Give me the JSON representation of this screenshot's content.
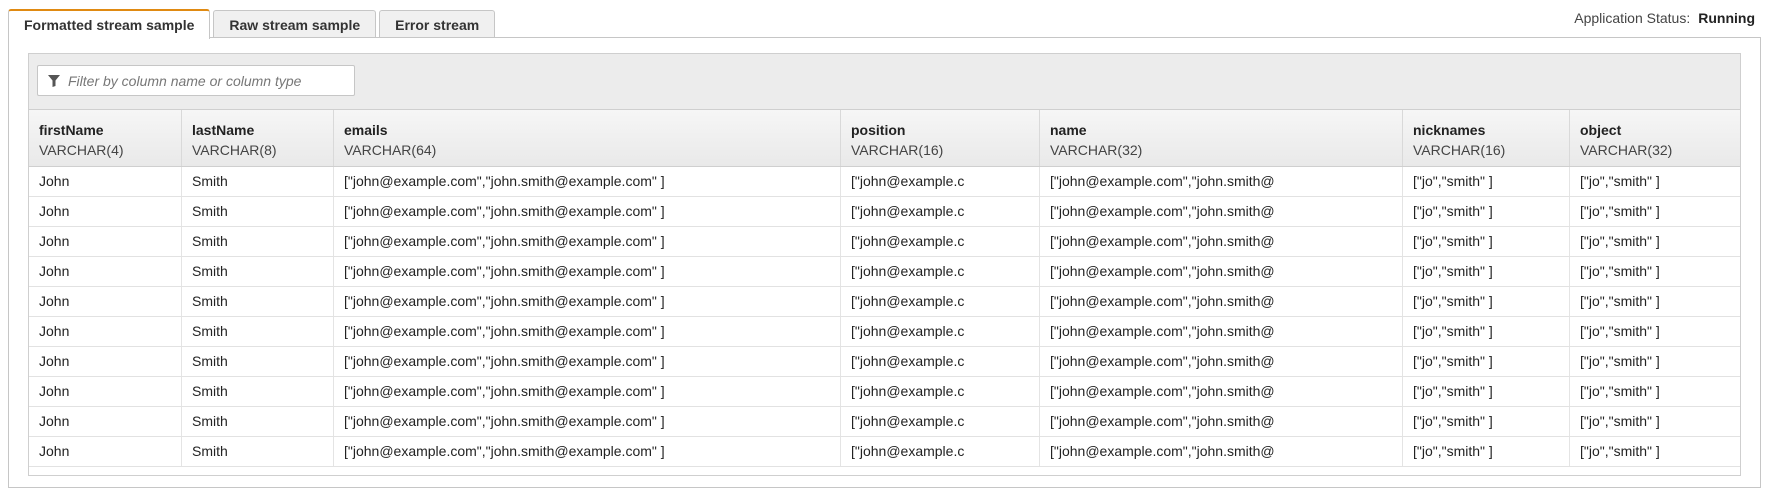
{
  "tabs": [
    {
      "label": "Formatted stream sample",
      "active": true
    },
    {
      "label": "Raw stream sample",
      "active": false
    },
    {
      "label": "Error stream",
      "active": false
    }
  ],
  "status": {
    "label": "Application Status:",
    "value": "Running"
  },
  "filter": {
    "placeholder": "Filter by column name or column type",
    "icon": "filter-icon"
  },
  "accent_color": "#e08a12",
  "columns": [
    {
      "name": "firstName",
      "type": "VARCHAR(4)"
    },
    {
      "name": "lastName",
      "type": "VARCHAR(8)"
    },
    {
      "name": "emails",
      "type": "VARCHAR(64)"
    },
    {
      "name": "position",
      "type": "VARCHAR(16)"
    },
    {
      "name": "name",
      "type": "VARCHAR(32)"
    },
    {
      "name": "nicknames",
      "type": "VARCHAR(16)"
    },
    {
      "name": "object",
      "type": "VARCHAR(32)"
    }
  ],
  "rows": [
    [
      "John",
      "Smith",
      "[\"john@example.com\",\"john.smith@example.com\" ]",
      "[\"john@example.c",
      "[\"john@example.com\",\"john.smith@",
      "[\"jo\",\"smith\" ]",
      "[\"jo\",\"smith\" ]"
    ],
    [
      "John",
      "Smith",
      "[\"john@example.com\",\"john.smith@example.com\" ]",
      "[\"john@example.c",
      "[\"john@example.com\",\"john.smith@",
      "[\"jo\",\"smith\" ]",
      "[\"jo\",\"smith\" ]"
    ],
    [
      "John",
      "Smith",
      "[\"john@example.com\",\"john.smith@example.com\" ]",
      "[\"john@example.c",
      "[\"john@example.com\",\"john.smith@",
      "[\"jo\",\"smith\" ]",
      "[\"jo\",\"smith\" ]"
    ],
    [
      "John",
      "Smith",
      "[\"john@example.com\",\"john.smith@example.com\" ]",
      "[\"john@example.c",
      "[\"john@example.com\",\"john.smith@",
      "[\"jo\",\"smith\" ]",
      "[\"jo\",\"smith\" ]"
    ],
    [
      "John",
      "Smith",
      "[\"john@example.com\",\"john.smith@example.com\" ]",
      "[\"john@example.c",
      "[\"john@example.com\",\"john.smith@",
      "[\"jo\",\"smith\" ]",
      "[\"jo\",\"smith\" ]"
    ],
    [
      "John",
      "Smith",
      "[\"john@example.com\",\"john.smith@example.com\" ]",
      "[\"john@example.c",
      "[\"john@example.com\",\"john.smith@",
      "[\"jo\",\"smith\" ]",
      "[\"jo\",\"smith\" ]"
    ],
    [
      "John",
      "Smith",
      "[\"john@example.com\",\"john.smith@example.com\" ]",
      "[\"john@example.c",
      "[\"john@example.com\",\"john.smith@",
      "[\"jo\",\"smith\" ]",
      "[\"jo\",\"smith\" ]"
    ],
    [
      "John",
      "Smith",
      "[\"john@example.com\",\"john.smith@example.com\" ]",
      "[\"john@example.c",
      "[\"john@example.com\",\"john.smith@",
      "[\"jo\",\"smith\" ]",
      "[\"jo\",\"smith\" ]"
    ],
    [
      "John",
      "Smith",
      "[\"john@example.com\",\"john.smith@example.com\" ]",
      "[\"john@example.c",
      "[\"john@example.com\",\"john.smith@",
      "[\"jo\",\"smith\" ]",
      "[\"jo\",\"smith\" ]"
    ],
    [
      "John",
      "Smith",
      "[\"john@example.com\",\"john.smith@example.com\" ]",
      "[\"john@example.c",
      "[\"john@example.com\",\"john.smith@",
      "[\"jo\",\"smith\" ]",
      "[\"jo\",\"smith\" ]"
    ]
  ]
}
